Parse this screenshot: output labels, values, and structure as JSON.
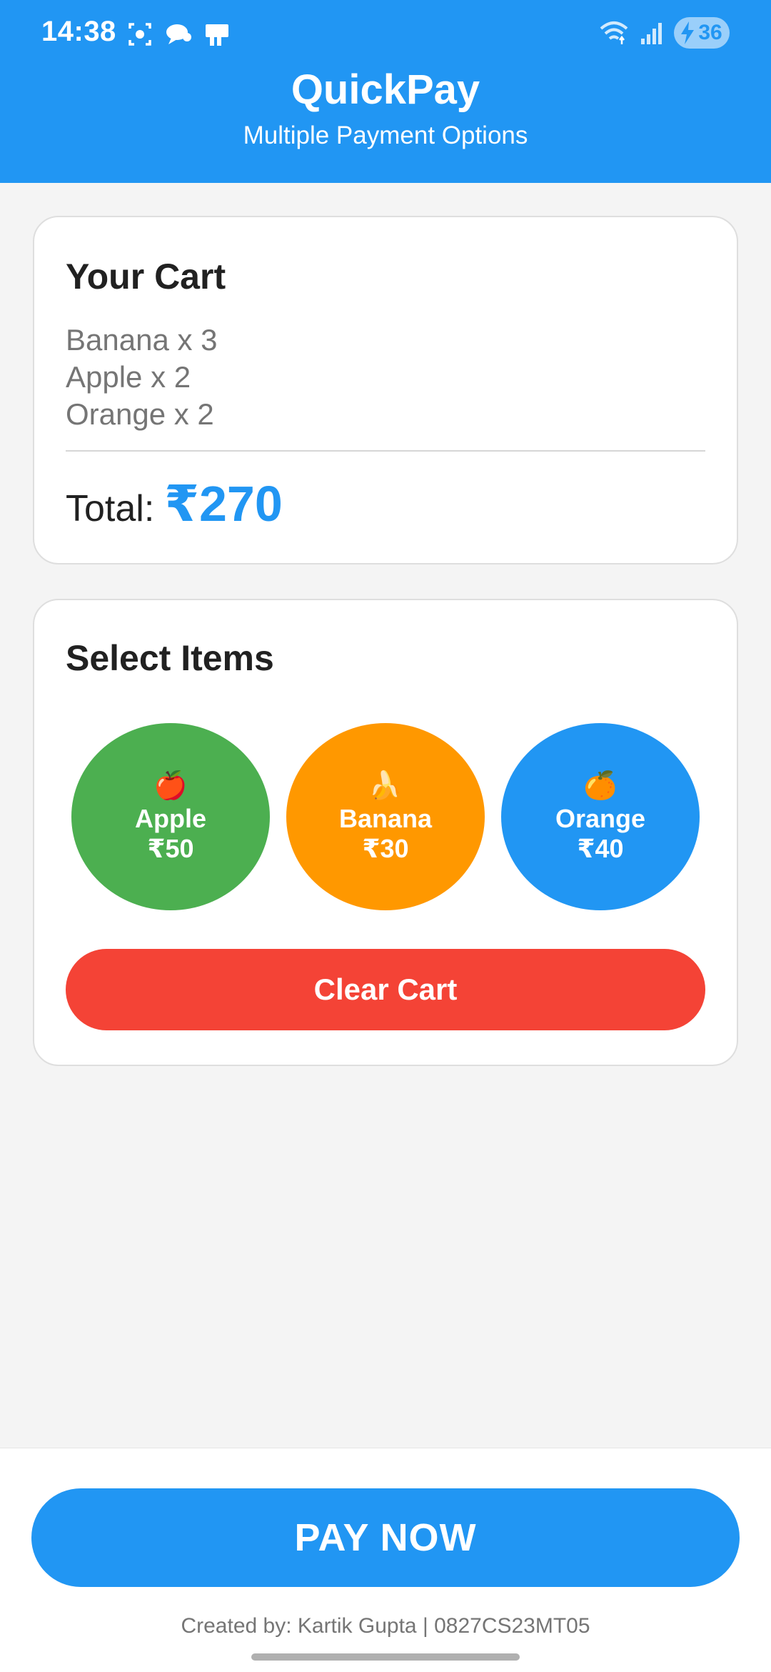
{
  "status_bar": {
    "time": "14:38",
    "battery": "36"
  },
  "header": {
    "title": "QuickPay",
    "subtitle": "Multiple Payment Options"
  },
  "cart": {
    "title": "Your Cart",
    "items": [
      "Banana x 3",
      "Apple x 2",
      "Orange x 2"
    ],
    "total_label": "Total:",
    "total_value": "₹270"
  },
  "select": {
    "title": "Select Items",
    "fruits": [
      {
        "emoji": "🍎",
        "name": "Apple",
        "price": "₹50",
        "color": "#4caf50"
      },
      {
        "emoji": "🍌",
        "name": "Banana",
        "price": "₹30",
        "color": "#ff9800"
      },
      {
        "emoji": "🍊",
        "name": "Orange",
        "price": "₹40",
        "color": "#2196f3"
      }
    ],
    "clear_label": "Clear Cart"
  },
  "footer": {
    "pay_label": "PAY NOW",
    "credit": "Created by: Kartik Gupta | 0827CS23MT05"
  },
  "colors": {
    "primary": "#2196f3",
    "danger": "#f44336",
    "background": "#f4f4f4"
  }
}
